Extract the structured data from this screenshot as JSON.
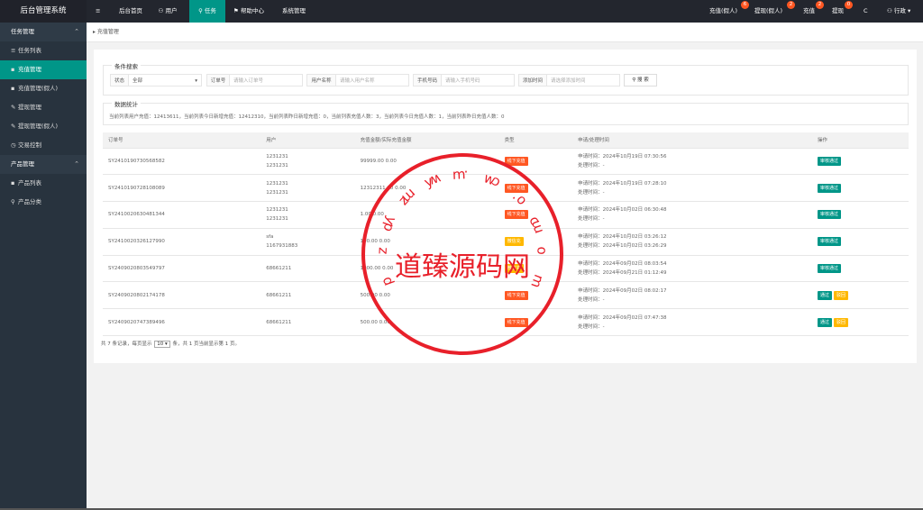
{
  "sidebar": {
    "title": "后台管理系统",
    "groups": [
      {
        "label": "任务管理",
        "items": [
          {
            "icon": "≡",
            "label": "任务列表",
            "active": false
          },
          {
            "icon": "▪",
            "label": "充值管理",
            "active": true
          },
          {
            "icon": "▪",
            "label": "充值管理(假人)",
            "active": false
          },
          {
            "icon": "✎",
            "label": "提现管理",
            "active": false
          },
          {
            "icon": "✎",
            "label": "提现管理(假人)",
            "active": false
          },
          {
            "icon": "◷",
            "label": "交易控制",
            "active": false
          }
        ]
      },
      {
        "label": "产品管理",
        "items": [
          {
            "icon": "▪",
            "label": "产品列表",
            "active": false
          },
          {
            "icon": "⚲",
            "label": "产品分类",
            "active": false
          }
        ]
      }
    ]
  },
  "topbar": {
    "menu_icon": "≡",
    "tabs": [
      "后台首页",
      "用户",
      "任务",
      "帮助中心",
      "系统管理"
    ],
    "tab_icons": [
      "",
      "⚇",
      "⚲",
      "⚑",
      ""
    ],
    "right": [
      {
        "label": "充值(假人)",
        "badge": "6"
      },
      {
        "label": "提现(假人)",
        "badge": "2"
      },
      {
        "label": "充值",
        "badge": "2"
      },
      {
        "label": "提现",
        "badge": "0"
      }
    ],
    "refresh_icon": "C",
    "user": "行政"
  },
  "breadcrumb": "充值管理",
  "search": {
    "legend": "条件搜索",
    "status_label": "状态",
    "status_value": "全部",
    "order_label": "订单号",
    "order_placeholder": "请输入订单号",
    "user_label": "用户名称",
    "user_placeholder": "请输入用户名称",
    "phone_label": "手机号码",
    "phone_placeholder": "请输入手机号码",
    "time_label": "添加时间",
    "time_placeholder": "请选择添加时间",
    "button": "搜 索"
  },
  "stats": {
    "legend": "数据统计",
    "text": "当前列表用户充值：12413611，当前列表今日新增充值：12412310，当前列表昨日新增充值：0，当前列表充值人数：3，当前列表今日充值人数：1，当前列表昨日充值人数：0"
  },
  "table": {
    "headers": [
      "订单号",
      "用户",
      "充值金额/实际充值金额",
      "类型",
      "申请/处理时间",
      "操作"
    ],
    "rows": [
      {
        "order": "SY2410190730568582",
        "user1": "1231231",
        "user2": "1231231",
        "amount": "99999.00 0.00",
        "type": "线下充值",
        "type_color": "#ff5722",
        "apply": "申请时间：2024年10月19日 07:30:56",
        "process": "处理时间：-",
        "actions": [
          {
            "label": "审核通过",
            "color": "#009688"
          }
        ]
      },
      {
        "order": "SY2410190728108089",
        "user1": "1231231",
        "user2": "1231231",
        "amount": "12312311.00 0.00",
        "type": "线下充值",
        "type_color": "#ff5722",
        "apply": "申请时间：2024年10月19日 07:28:10",
        "process": "处理时间：-",
        "actions": [
          {
            "label": "审核通过",
            "color": "#009688"
          }
        ]
      },
      {
        "order": "SY2410020630481344",
        "user1": "1231231",
        "user2": "1231231",
        "amount": "1.00 0.00",
        "type": "线下充值",
        "type_color": "#ff5722",
        "apply": "申请时间：2024年10月02日 06:30:48",
        "process": "处理时间：-",
        "actions": [
          {
            "label": "审核通过",
            "color": "#009688"
          }
        ]
      },
      {
        "order": "SY2410020326127990",
        "user1": "sfa",
        "user2": "1167931883",
        "amount": "100.00 0.00",
        "type": "微信充",
        "type_color": "#ffb800",
        "apply": "申请时间：2024年10月02日 03:26:12",
        "process": "处理时间：2024年10月02日 03:26:29",
        "actions": [
          {
            "label": "审核通过",
            "color": "#009688"
          }
        ]
      },
      {
        "order": "SY2409020803549797",
        "user1": "68661211",
        "user2": "",
        "amount": "1000.00 0.00",
        "type": "微信充",
        "type_color": "#ffb800",
        "apply": "申请时间：2024年09月02日 08:03:54",
        "process": "处理时间：2024年09月21日 01:12:49",
        "actions": [
          {
            "label": "审核通过",
            "color": "#009688"
          }
        ]
      },
      {
        "order": "SY2409020802174178",
        "user1": "68661211",
        "user2": "",
        "amount": "500.00 0.00",
        "type": "线下充值",
        "type_color": "#ff5722",
        "apply": "申请时间：2024年09月02日 08:02:17",
        "process": "处理时间：-",
        "actions": [
          {
            "label": "通过",
            "color": "#009688"
          },
          {
            "label": "驳回",
            "color": "#ffb800"
          }
        ]
      },
      {
        "order": "SY2409020747389496",
        "user1": "68661211",
        "user2": "",
        "amount": "500.00 0.00",
        "type": "线下充值",
        "type_color": "#ff5722",
        "apply": "申请时间：2024年09月02日 07:47:38",
        "process": "处理时间：-",
        "actions": [
          {
            "label": "通过",
            "color": "#009688"
          },
          {
            "label": "驳回",
            "color": "#ffb800"
          }
        ]
      }
    ]
  },
  "pager": {
    "prefix": "共 7 条记录，每页显示",
    "per_page": "10",
    "suffix": "条，共 1 页当前显示第 1 页。"
  },
  "watermark": {
    "center": "道臻源码网",
    "ring": "dzymw.com",
    "color": "#e8202a"
  }
}
